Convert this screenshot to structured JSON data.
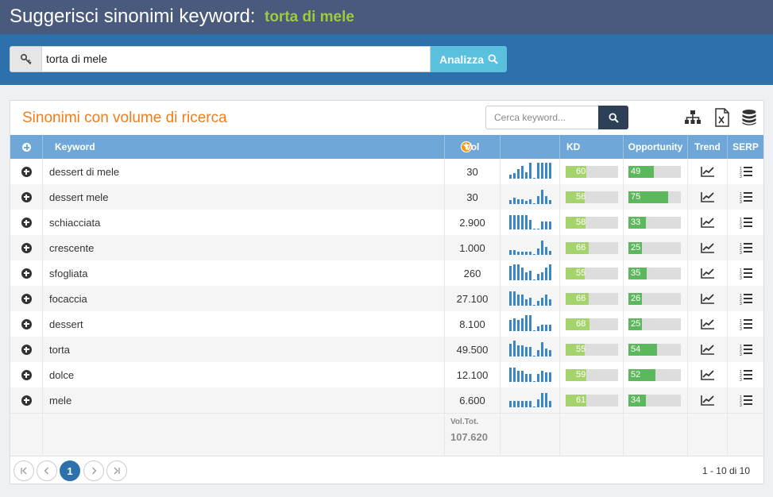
{
  "header": {
    "title": "Suggerisci sinonimi keyword:",
    "keyword": "torta di mele"
  },
  "search": {
    "value": "torta di mele",
    "button_label": "Analizza",
    "icon": "key-icon"
  },
  "panel": {
    "title": "Sinonimi con volume di ricerca",
    "search_placeholder": "Cerca keyword...",
    "tools": [
      "sitemap-icon",
      "excel-export-icon",
      "database-icon"
    ]
  },
  "table": {
    "columns": {
      "keyword": "Keyword",
      "vol": "Vol",
      "kd": "KD",
      "opportunity": "Opportunity",
      "trend": "Trend",
      "serp": "SERP"
    },
    "rows": [
      {
        "keyword": "dessert di mele",
        "vol": "30",
        "kd": 60,
        "opportunity": 49,
        "trend": [
          5,
          7,
          12,
          16,
          8,
          20,
          0,
          20,
          20,
          20,
          20
        ]
      },
      {
        "keyword": "dessert mele",
        "vol": "30",
        "kd": 56,
        "opportunity": 75,
        "trend": [
          5,
          8,
          6,
          6,
          4,
          6,
          1,
          10,
          18,
          10,
          5
        ]
      },
      {
        "keyword": "schiacciata",
        "vol": "2.900",
        "kd": 58,
        "opportunity": 33,
        "trend": [
          18,
          18,
          18,
          18,
          18,
          12,
          1,
          1,
          10,
          10,
          10
        ]
      },
      {
        "keyword": "crescente",
        "vol": "1.000",
        "kd": 66,
        "opportunity": 25,
        "trend": [
          6,
          6,
          4,
          4,
          4,
          4,
          1,
          8,
          18,
          10,
          5
        ]
      },
      {
        "keyword": "sfogliata",
        "vol": "260",
        "kd": 55,
        "opportunity": 35,
        "trend": [
          18,
          20,
          20,
          16,
          10,
          12,
          1,
          8,
          10,
          16,
          20
        ]
      },
      {
        "keyword": "focaccia",
        "vol": "27.100",
        "kd": 66,
        "opportunity": 26,
        "trend": [
          18,
          18,
          14,
          14,
          8,
          10,
          1,
          6,
          10,
          14,
          8
        ]
      },
      {
        "keyword": "dessert",
        "vol": "8.100",
        "kd": 68,
        "opportunity": 25,
        "trend": [
          14,
          16,
          14,
          16,
          20,
          20,
          1,
          6,
          8,
          8,
          8
        ]
      },
      {
        "keyword": "torta",
        "vol": "49.500",
        "kd": 55,
        "opportunity": 54,
        "trend": [
          16,
          20,
          14,
          14,
          12,
          12,
          1,
          8,
          18,
          10,
          8
        ]
      },
      {
        "keyword": "dolce",
        "vol": "12.100",
        "kd": 59,
        "opportunity": 52,
        "trend": [
          18,
          18,
          14,
          14,
          10,
          10,
          1,
          10,
          14,
          12,
          12
        ]
      },
      {
        "keyword": "mele",
        "vol": "6.600",
        "kd": 61,
        "opportunity": 34,
        "trend": [
          8,
          8,
          8,
          8,
          8,
          8,
          1,
          10,
          18,
          18,
          8
        ]
      }
    ],
    "total_label": "Vol.Tot.",
    "total_value": "107.620"
  },
  "pagination": {
    "current": "1",
    "info": "1 - 10 di 10"
  },
  "colors": {
    "header_bg": "#4a5a7c",
    "keyword_accent": "#9ccc3c",
    "search_band": "#2c71ab",
    "analyze_button": "#5bc0de",
    "panel_title": "#f07d1a",
    "table_header": "#6fa8d8",
    "kd_bar": "#a6d46c",
    "opportunity_bar": "#5cb85c",
    "spark": "#3a87c8"
  }
}
